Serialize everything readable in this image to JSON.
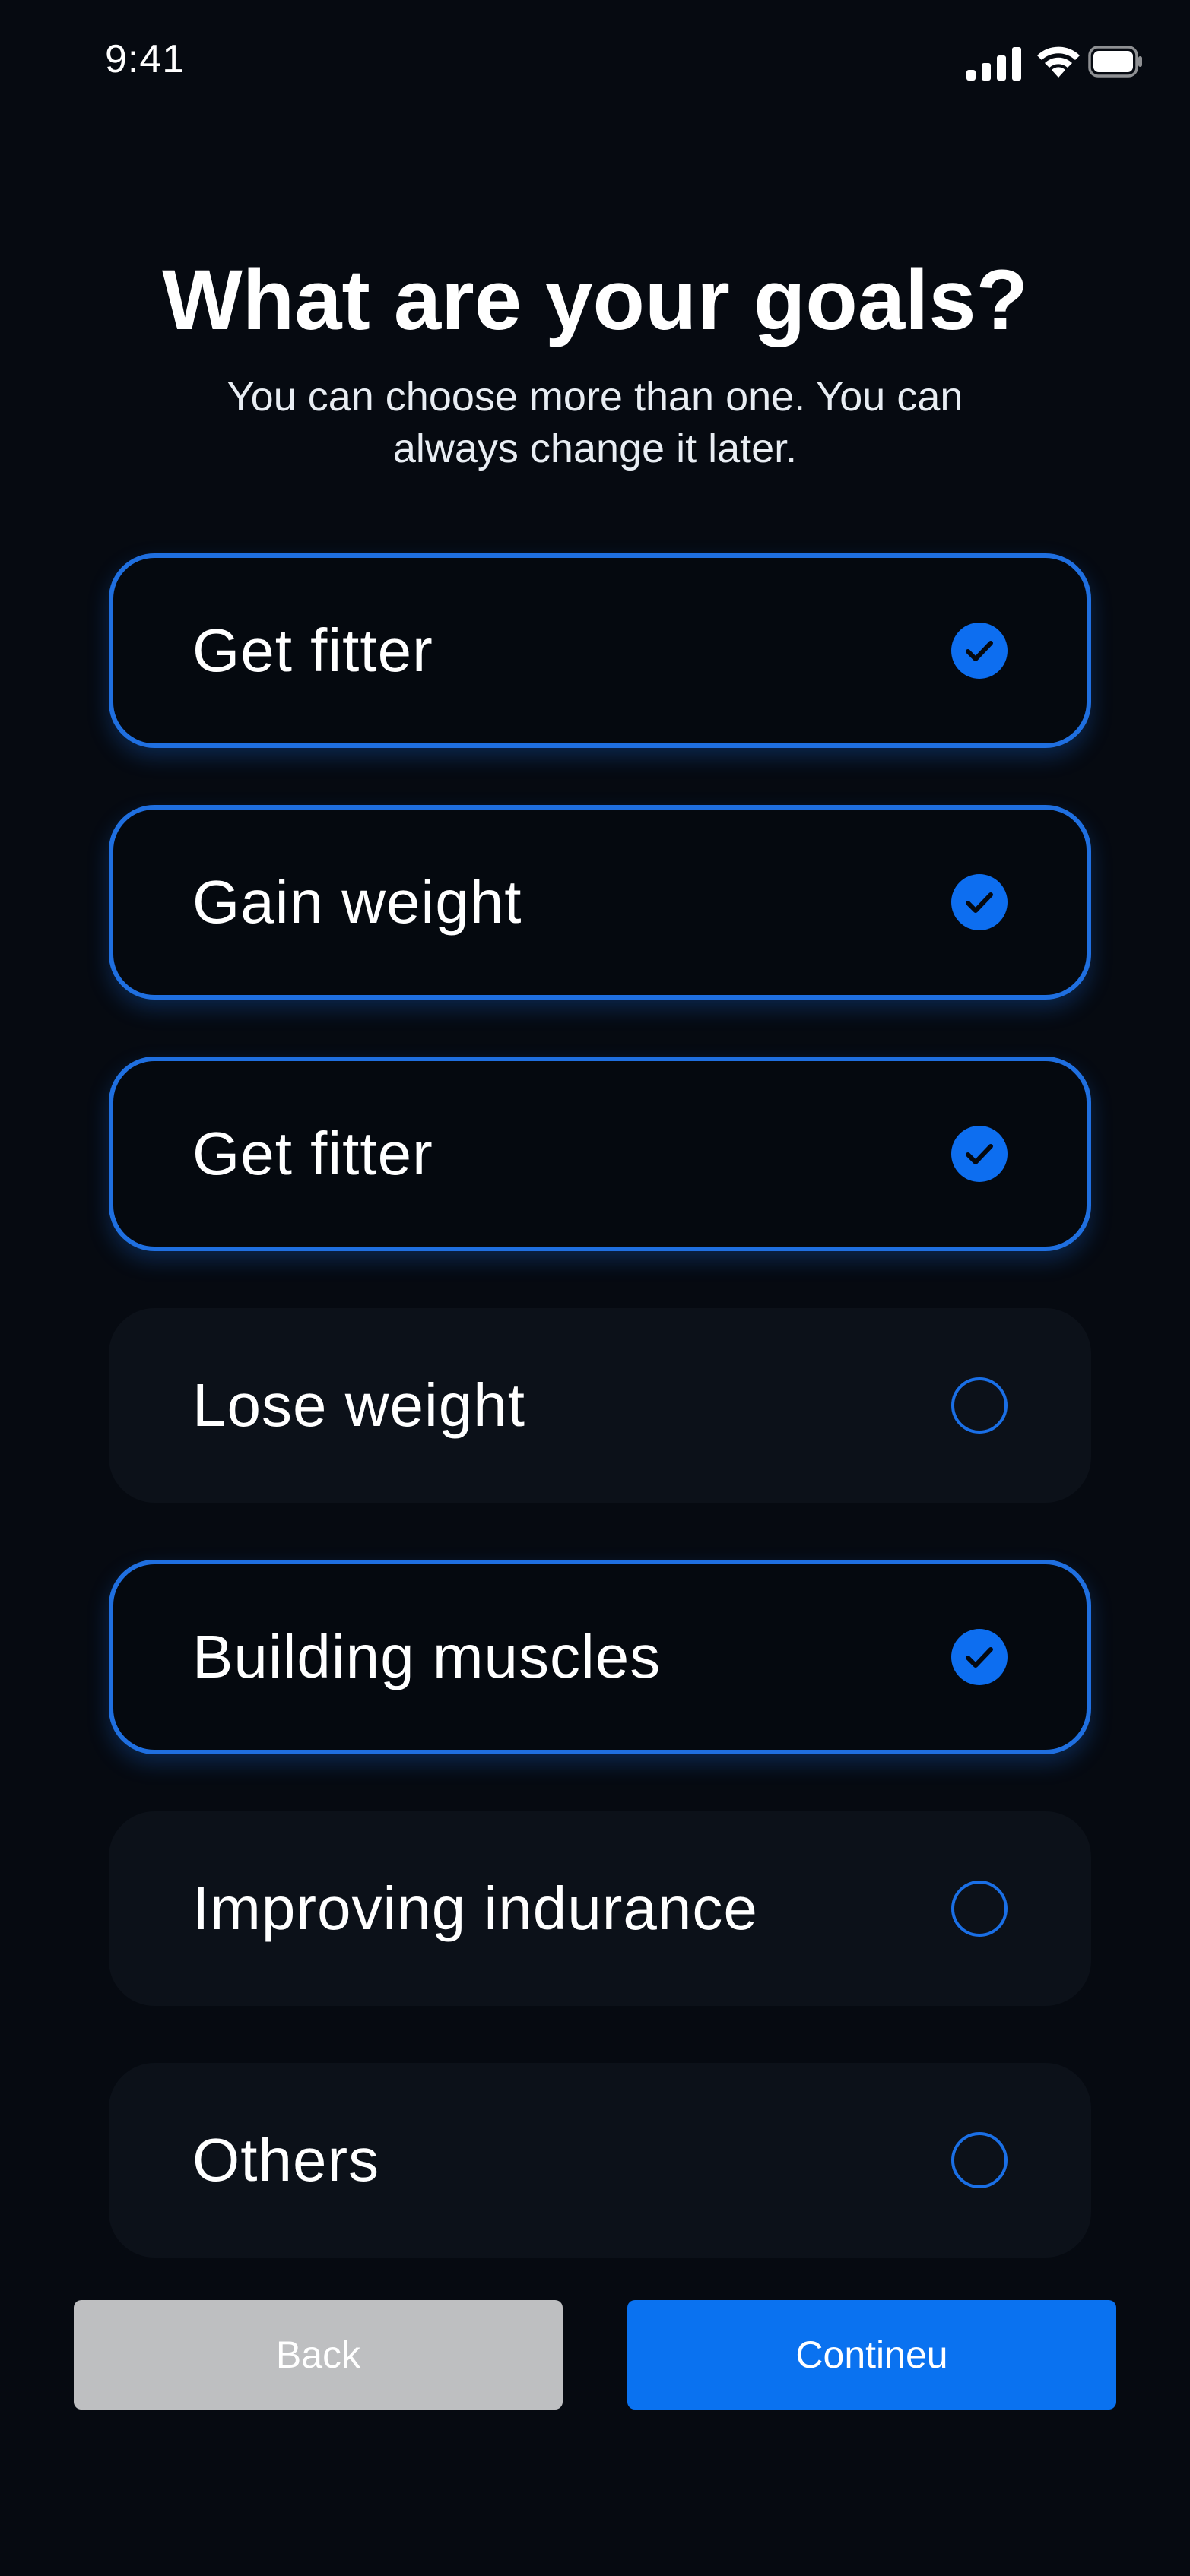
{
  "status_bar": {
    "time": "9:41",
    "icons": [
      "cellular-signal-icon",
      "wifi-icon",
      "battery-icon"
    ]
  },
  "header": {
    "title": "What are your goals?",
    "subtitle": "You can choose more than one. You can always change it later."
  },
  "options": [
    {
      "label": "Get fitter",
      "selected": true
    },
    {
      "label": "Gain weight",
      "selected": true
    },
    {
      "label": "Get fitter",
      "selected": true
    },
    {
      "label": "Lose weight",
      "selected": false
    },
    {
      "label": "Building muscles",
      "selected": true
    },
    {
      "label": "Improving indurance",
      "selected": false
    },
    {
      "label": "Others",
      "selected": false
    }
  ],
  "footer": {
    "back_label": "Back",
    "continue_label": "Contineu"
  },
  "colors": {
    "background": "#060a11",
    "accent": "#0a72f0",
    "selected_border": "#1f6fe0",
    "unselected_card": "#0c1119",
    "back_button": "#bebfc1"
  }
}
